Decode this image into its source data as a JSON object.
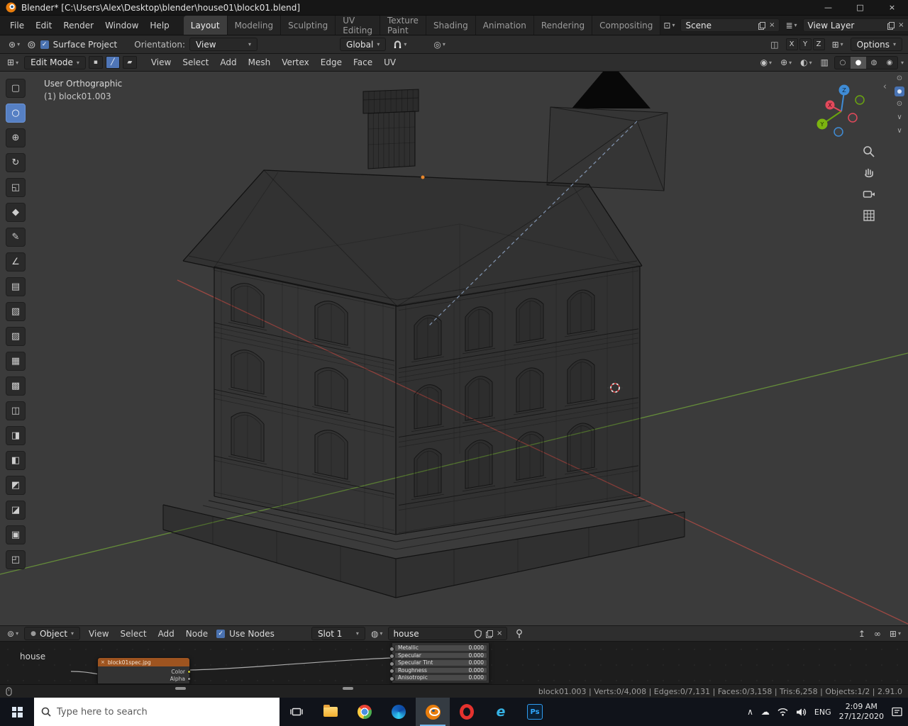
{
  "window": {
    "title": "Blender* [C:\\Users\\Alex\\Desktop\\blender\\house01\\block01.blend]"
  },
  "topbar": {
    "menus": [
      "File",
      "Edit",
      "Render",
      "Window",
      "Help"
    ],
    "workspaces": [
      "Layout",
      "Modeling",
      "Sculpting",
      "UV Editing",
      "Texture Paint",
      "Shading",
      "Animation",
      "Rendering",
      "Compositing"
    ],
    "active_workspace": "Layout",
    "scene_value": "Scene",
    "view_layer_value": "View Layer"
  },
  "tool_header": {
    "surface_project_label": "Surface Project",
    "orientation_label": "Orientation:",
    "orientation_value": "View",
    "transform_orientation": "Global",
    "mirror_axes": [
      "X",
      "Y",
      "Z"
    ],
    "options_label": "Options"
  },
  "edit_header": {
    "mode_value": "Edit Mode",
    "menus": [
      "View",
      "Select",
      "Add",
      "Mesh",
      "Vertex",
      "Edge",
      "Face",
      "UV"
    ]
  },
  "viewport": {
    "view_name": "User Orthographic",
    "object_label": "(1) block01.003",
    "gizmo_axes": {
      "x": "X",
      "y": "Y",
      "z": "Z"
    }
  },
  "toolbar_tools": [
    {
      "name": "select-box",
      "glyph": "▢"
    },
    {
      "name": "select-circle",
      "glyph": "○"
    },
    {
      "name": "move",
      "glyph": "⊕"
    },
    {
      "name": "rotate",
      "glyph": "↻"
    },
    {
      "name": "scale",
      "glyph": "◱"
    },
    {
      "name": "transform",
      "glyph": "◆"
    },
    {
      "name": "annotate",
      "glyph": "✎"
    },
    {
      "name": "measure",
      "glyph": "∠"
    },
    {
      "name": "extrude-region",
      "glyph": "▤"
    },
    {
      "name": "inset-faces",
      "glyph": "▧"
    },
    {
      "name": "bevel",
      "glyph": "▨"
    },
    {
      "name": "loop-cut",
      "glyph": "▦"
    },
    {
      "name": "knife",
      "glyph": "▩"
    },
    {
      "name": "poly-build",
      "glyph": "◫"
    },
    {
      "name": "spin",
      "glyph": "◨"
    },
    {
      "name": "smooth",
      "glyph": "◧"
    },
    {
      "name": "edge-slide",
      "glyph": "◩"
    },
    {
      "name": "shrink-fatten",
      "glyph": "◪"
    },
    {
      "name": "shear",
      "glyph": "▣"
    },
    {
      "name": "rip-region",
      "glyph": "◰"
    }
  ],
  "active_tool_index": 1,
  "node_editor": {
    "object_type": "Object",
    "menus": [
      "View",
      "Select",
      "Add",
      "Node"
    ],
    "use_nodes_label": "Use Nodes",
    "slot_value": "Slot 1",
    "breadcrumb": "house",
    "material_name": "house",
    "image_node_title": "block01spec.jpg",
    "image_node_sockets": [
      "Color",
      "Alpha"
    ],
    "bsdf_rows": [
      {
        "label": "Metallic",
        "value": "0.000"
      },
      {
        "label": "Specular",
        "value": "0.000"
      },
      {
        "label": "Specular Tint",
        "value": "0.000"
      },
      {
        "label": "Roughness",
        "value": "0.000"
      },
      {
        "label": "Anisotropic",
        "value": "0.000"
      }
    ]
  },
  "status_bar": {
    "stats": "block01.003  |  Verts:0/4,008 | Edges:0/7,131 | Faces:0/3,158 | Tris:6,258  |  Objects:1/2  |  2.91.0"
  },
  "taskbar": {
    "search_placeholder": "Type here to search",
    "language": "ENG",
    "time": "2:09 AM",
    "date": "27/12/2020",
    "ie_label": "e",
    "ps_label": "Ps"
  },
  "colors": {
    "accent_blue": "#4772b3",
    "blender_orange": "#e87d0d",
    "axis_x": "#e2495b",
    "axis_y": "#7cb410",
    "axis_z": "#3f8cd6"
  },
  "icons": {
    "minimize": "—",
    "maximize": "□",
    "close": "×",
    "caret": "▾",
    "check": "✓",
    "scene_icon": "⊡",
    "view_layer_icon": "≣",
    "tool_settings": "⊛",
    "active_tool": "⊚",
    "editor_viewport": "⊞",
    "editor_node": "⊚",
    "vertex_mode": "▪",
    "edge_mode": "╱",
    "face_mode": "▰",
    "visibility": "◉",
    "gizmo": "⊕",
    "overlays": "◐",
    "xray": "▥",
    "shade_wire": "○",
    "shade_solid": "●",
    "shade_material": "◍",
    "shade_render": "◉",
    "mirror": "◫",
    "prop_edit": "◎",
    "slot_sphere": "◍",
    "material_sphere": "●",
    "arrow_in": "↥",
    "chain": "∞",
    "grid": "⊞",
    "eye": "⊙",
    "chevron_down": "∨",
    "back_arrow": "‹",
    "tray_chevron": "∧",
    "cloud": "☁"
  }
}
